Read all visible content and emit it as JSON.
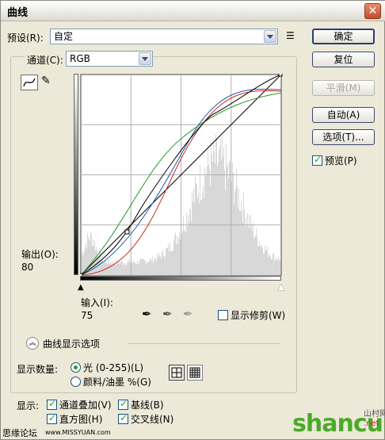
{
  "window": {
    "title": "曲线"
  },
  "preset": {
    "label": "预设(R):",
    "value": "自定"
  },
  "channel": {
    "label": "通道(C):",
    "value": "RGB"
  },
  "buttons": {
    "ok": "确定",
    "reset": "复位",
    "smooth": "平滑(M)",
    "auto": "自动(A)",
    "options": "选项(T)...",
    "preview": "预览(P)"
  },
  "output": {
    "label": "输出(O):",
    "value": "80"
  },
  "input": {
    "label": "输入(I):",
    "value": "75"
  },
  "show_clipping": "显示修剪(W)",
  "curve_display_options": "曲线显示选项",
  "display_amount": {
    "label": "显示数量:",
    "light": "光 (0-255)(L)",
    "pigment": "颜料/油墨 %(G)"
  },
  "show": {
    "label": "显示:",
    "channel_overlays": "通道叠加(V)",
    "baseline": "基线(B)",
    "histogram": "直方图(H)",
    "intersection": "交叉线(N)"
  },
  "footer": {
    "site": "思缘论坛",
    "url": "www.MISSYUAN.com",
    "logo": "shancun",
    "logo_net": ".net",
    "logo_cn": "山村网"
  },
  "colors": {
    "red": "#cc2a1a",
    "green": "#2a9a2a",
    "blue": "#1a5aaa",
    "accent": "#21a121"
  }
}
